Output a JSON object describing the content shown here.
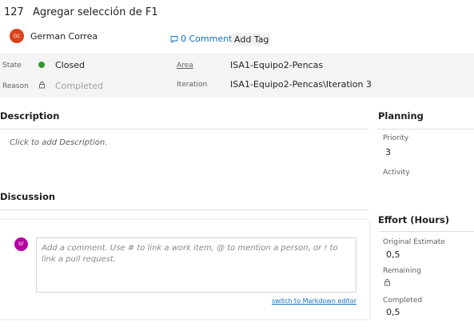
{
  "work_item": {
    "id": "127",
    "title": "Agregar selección de F1"
  },
  "owner": {
    "initials": "GC",
    "name": "German Correa",
    "avatar_color": "#d9441a"
  },
  "header_actions": {
    "comments_label": "0 Comments",
    "add_tag_label": "Add Tag"
  },
  "fields": {
    "state_label": "State",
    "state_value": "Closed",
    "state_color": "#339933",
    "reason_label": "Reason",
    "reason_value": "Completed",
    "area_label": "Area",
    "area_value": "ISA1-Equipo2-Pencas",
    "iteration_label": "Iteration",
    "iteration_value": "ISA1-Equipo2-Pencas\\Iteration 3"
  },
  "description": {
    "heading": "Description",
    "placeholder": "Click to add Description."
  },
  "discussion": {
    "heading": "Discussion",
    "user_initials": "SF",
    "user_avatar_color": "#b4009e",
    "comment_placeholder": "Add a comment. Use # to link a work item, @ to mention a person, or ! to link a pull request.",
    "markdown_link": "switch to Markdown editor"
  },
  "planning": {
    "heading": "Planning",
    "priority_label": "Priority",
    "priority_value": "3",
    "activity_label": "Activity"
  },
  "effort": {
    "heading": "Effort (Hours)",
    "original_estimate_label": "Original Estimate",
    "original_estimate_value": "0,5",
    "remaining_label": "Remaining",
    "completed_label": "Completed",
    "completed_value": "0,5"
  }
}
